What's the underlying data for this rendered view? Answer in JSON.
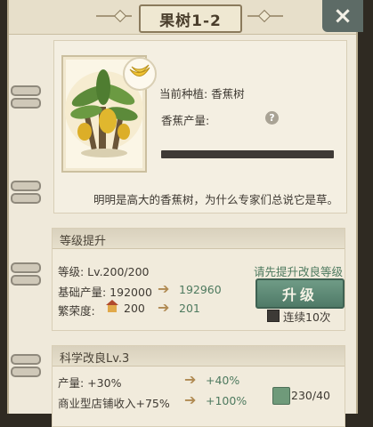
{
  "window": {
    "title": "果树1-2",
    "close_icon": "×"
  },
  "plant": {
    "current_label": "当前种植: 香蕉树",
    "yield_label": "香蕉产量:",
    "help_icon": "?",
    "description": "明明是高大的香蕉树，为什么专家们总说它是草。",
    "yield_progress": 1.0
  },
  "level": {
    "title": "等级提升",
    "level_text": "等级: Lv.200/200",
    "base_label": "基础产量: 192000",
    "base_next": "192960",
    "prosperity_label": "繁荣度:",
    "prosperity_value": "200",
    "prosperity_next": "201",
    "hint": "请先提升改良等级",
    "upgrade_label": "升级",
    "continuous_label": "连续10次",
    "arrow": "➔"
  },
  "science": {
    "title": "科学改良Lv.3",
    "yield_label": "产量: +30%",
    "yield_next": "+40%",
    "shop_label": "商业型店铺收入+75%",
    "shop_next": "+100%",
    "books": "230/40"
  },
  "colors": {
    "accent_green": "#4e7a5f",
    "arrow": "#b08a52",
    "button": "#5f8a76"
  }
}
